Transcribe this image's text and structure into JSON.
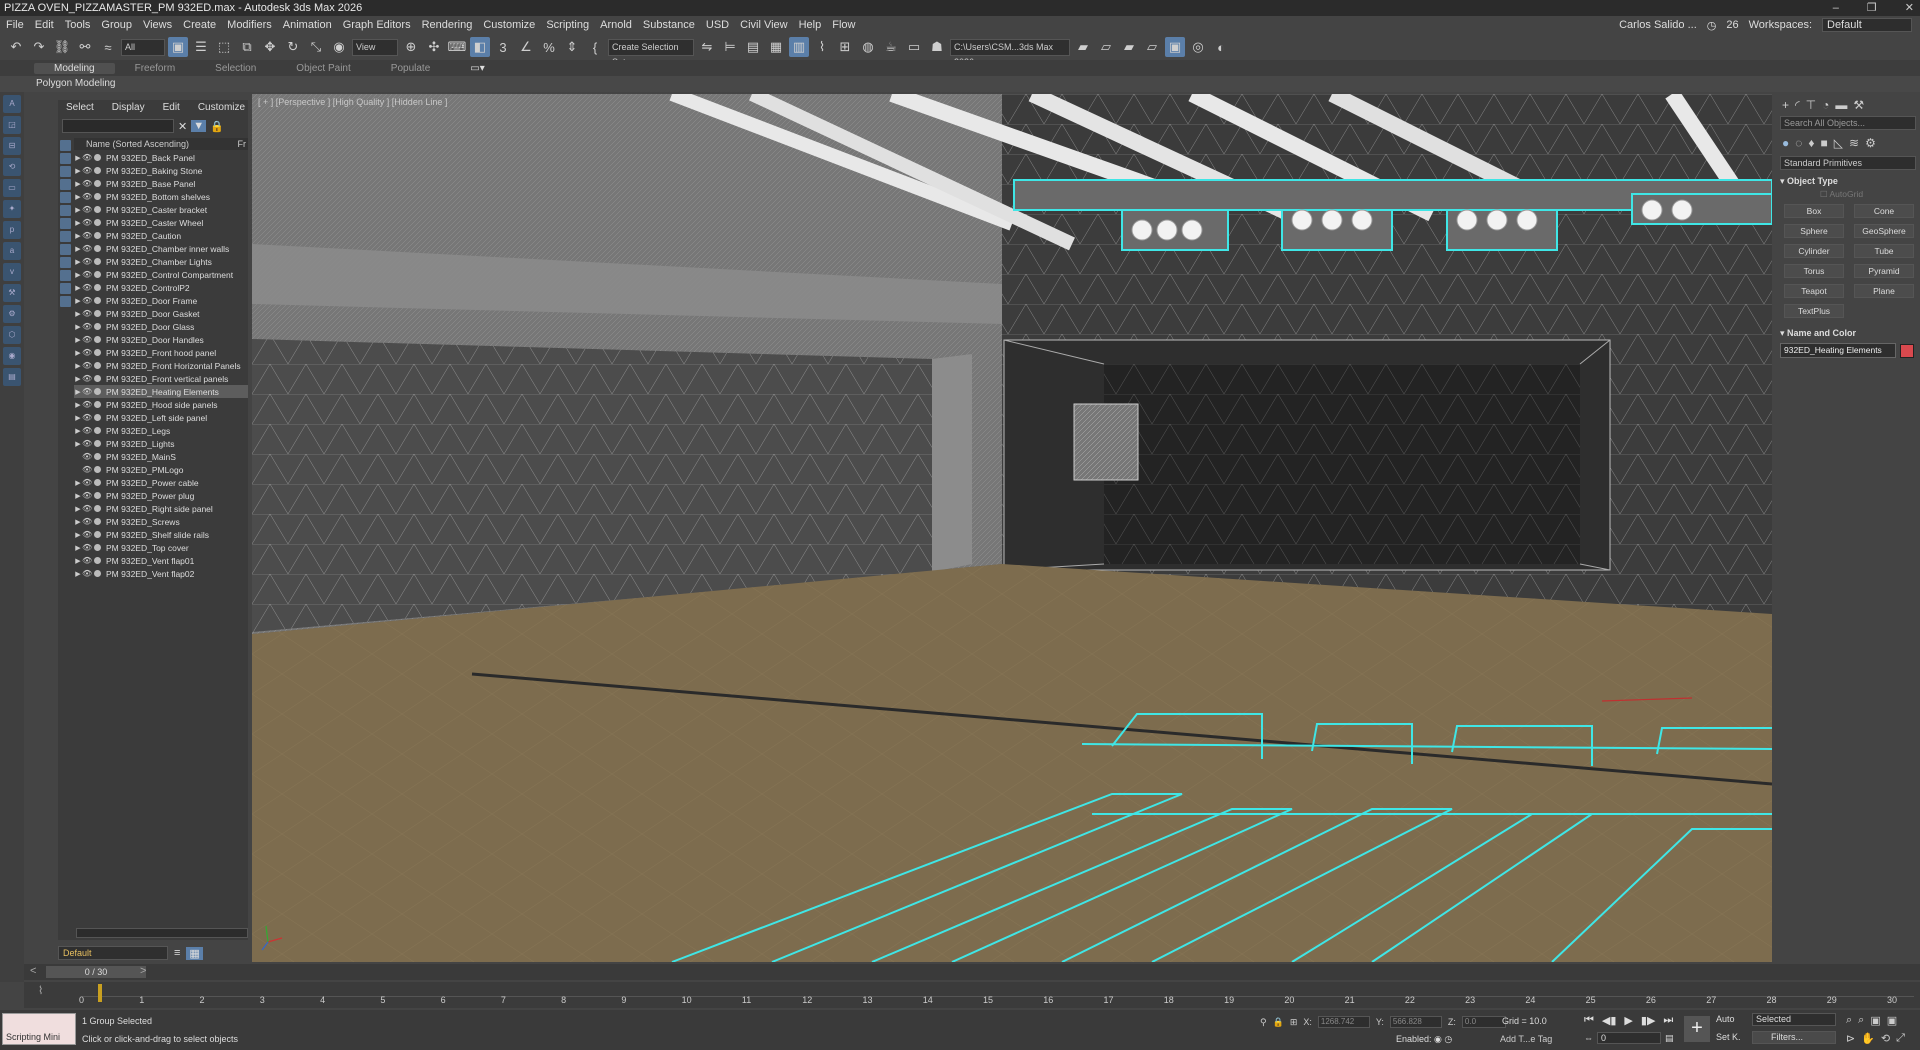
{
  "window": {
    "title": "PIZZA OVEN_PIZZAMASTER_PM 932ED.max - Autodesk 3ds Max 2026",
    "controls": [
      "–",
      "❐",
      "✕"
    ]
  },
  "menu": {
    "items": [
      "File",
      "Edit",
      "Tools",
      "Group",
      "Views",
      "Create",
      "Modifiers",
      "Animation",
      "Graph Editors",
      "Rendering",
      "Customize",
      "Scripting",
      "Arnold",
      "Substance",
      "USD",
      "Civil View",
      "Help",
      "Flow"
    ],
    "user": "Carlos Salido ...",
    "count": "26",
    "workspaces_label": "Workspaces:",
    "workspace": "Default"
  },
  "toolbar": {
    "filter": "All",
    "ref_coord": "View",
    "selection_set": "Create Selection Set",
    "project_path": "C:\\Users\\CSM...3ds Max 2026"
  },
  "ribbon": {
    "tabs": [
      "Modeling",
      "Freeform",
      "Selection",
      "Object Paint",
      "Populate"
    ],
    "active": "Modeling",
    "panel": "Polygon Modeling"
  },
  "scene_explorer": {
    "tabs": [
      "Select",
      "Display",
      "Edit",
      "Customize"
    ],
    "column": "Name (Sorted Ascending)",
    "column2": "Fr",
    "items": [
      {
        "name": "PM 932ED_Back Panel",
        "group": true
      },
      {
        "name": "PM 932ED_Baking Stone",
        "group": true
      },
      {
        "name": "PM 932ED_Base Panel",
        "group": true
      },
      {
        "name": "PM 932ED_Bottom shelves",
        "group": true
      },
      {
        "name": "PM 932ED_Caster bracket",
        "group": true
      },
      {
        "name": "PM 932ED_Caster Wheel",
        "group": true
      },
      {
        "name": "PM 932ED_Caution",
        "group": true
      },
      {
        "name": "PM 932ED_Chamber inner walls",
        "group": true
      },
      {
        "name": "PM 932ED_Chamber Lights",
        "group": true
      },
      {
        "name": "PM 932ED_Control Compartment",
        "group": true
      },
      {
        "name": "PM 932ED_ControlP2",
        "group": true
      },
      {
        "name": "PM 932ED_Door Frame",
        "group": true
      },
      {
        "name": "PM 932ED_Door Gasket",
        "group": true
      },
      {
        "name": "PM 932ED_Door Glass",
        "group": true
      },
      {
        "name": "PM 932ED_Door Handles",
        "group": true
      },
      {
        "name": "PM 932ED_Front hood panel",
        "group": true
      },
      {
        "name": "PM 932ED_Front Horizontal Panels",
        "group": true
      },
      {
        "name": "PM 932ED_Front vertical panels",
        "group": true
      },
      {
        "name": "PM 932ED_Heating Elements",
        "group": true,
        "selected": true
      },
      {
        "name": "PM 932ED_Hood side panels",
        "group": true
      },
      {
        "name": "PM 932ED_Left side panel",
        "group": true
      },
      {
        "name": "PM 932ED_Legs",
        "group": true
      },
      {
        "name": "PM 932ED_Lights",
        "group": true
      },
      {
        "name": "PM 932ED_MainS",
        "group": false
      },
      {
        "name": "PM 932ED_PMLogo",
        "group": false
      },
      {
        "name": "PM 932ED_Power cable",
        "group": true
      },
      {
        "name": "PM 932ED_Power plug",
        "group": true
      },
      {
        "name": "PM 932ED_Right side panel",
        "group": true
      },
      {
        "name": "PM 932ED_Screws",
        "group": true
      },
      {
        "name": "PM 932ED_Shelf slide rails",
        "group": true
      },
      {
        "name": "PM 932ED_Top cover",
        "group": true
      },
      {
        "name": "PM 932ED_Vent flap01",
        "group": true
      },
      {
        "name": "PM 932ED_Vent flap02",
        "group": true
      }
    ],
    "layer": "Default"
  },
  "viewport": {
    "label": "[ + ] [Perspective ] [High Quality ] [Hidden Line ]"
  },
  "command_panel": {
    "search": "Search All Objects...",
    "category": "Standard Primitives",
    "object_type_title": "Object Type",
    "autogrid": "AutoGrid",
    "buttons": [
      "Box",
      "Cone",
      "Sphere",
      "GeoSphere",
      "Cylinder",
      "Tube",
      "Torus",
      "Pyramid",
      "Teapot",
      "Plane",
      "TextPlus"
    ],
    "name_color_title": "Name and Color",
    "object_name": "932ED_Heating Elements",
    "object_color": "#d9494e"
  },
  "timeline": {
    "frame": "0 / 30",
    "ticks": [
      "0",
      "1",
      "2",
      "3",
      "4",
      "5",
      "6",
      "7",
      "8",
      "9",
      "10",
      "11",
      "12",
      "13",
      "14",
      "15",
      "16",
      "17",
      "18",
      "19",
      "20",
      "21",
      "22",
      "23",
      "24",
      "25",
      "26",
      "27",
      "28",
      "29",
      "30"
    ]
  },
  "status": {
    "maxscript": "Scripting Mini",
    "selection": "1 Group Selected",
    "prompt": "Click or click-and-drag to select objects",
    "x_label": "X:",
    "x": "1268.742",
    "y_label": "Y:",
    "y": "566.828",
    "z_label": "Z:",
    "z": "0.0",
    "grid": "Grid = 10.0",
    "enabled": "Enabled:",
    "add_tag": "Add T...e Tag",
    "auto": "Auto",
    "set_key": "Set K.",
    "key_filter": "Selected",
    "filters": "Filters...",
    "frame_field": "0"
  },
  "colors": {
    "selection_wire": "#3fe6e6",
    "floor": "#7d6c4e",
    "accent": "#5b7fa9"
  }
}
